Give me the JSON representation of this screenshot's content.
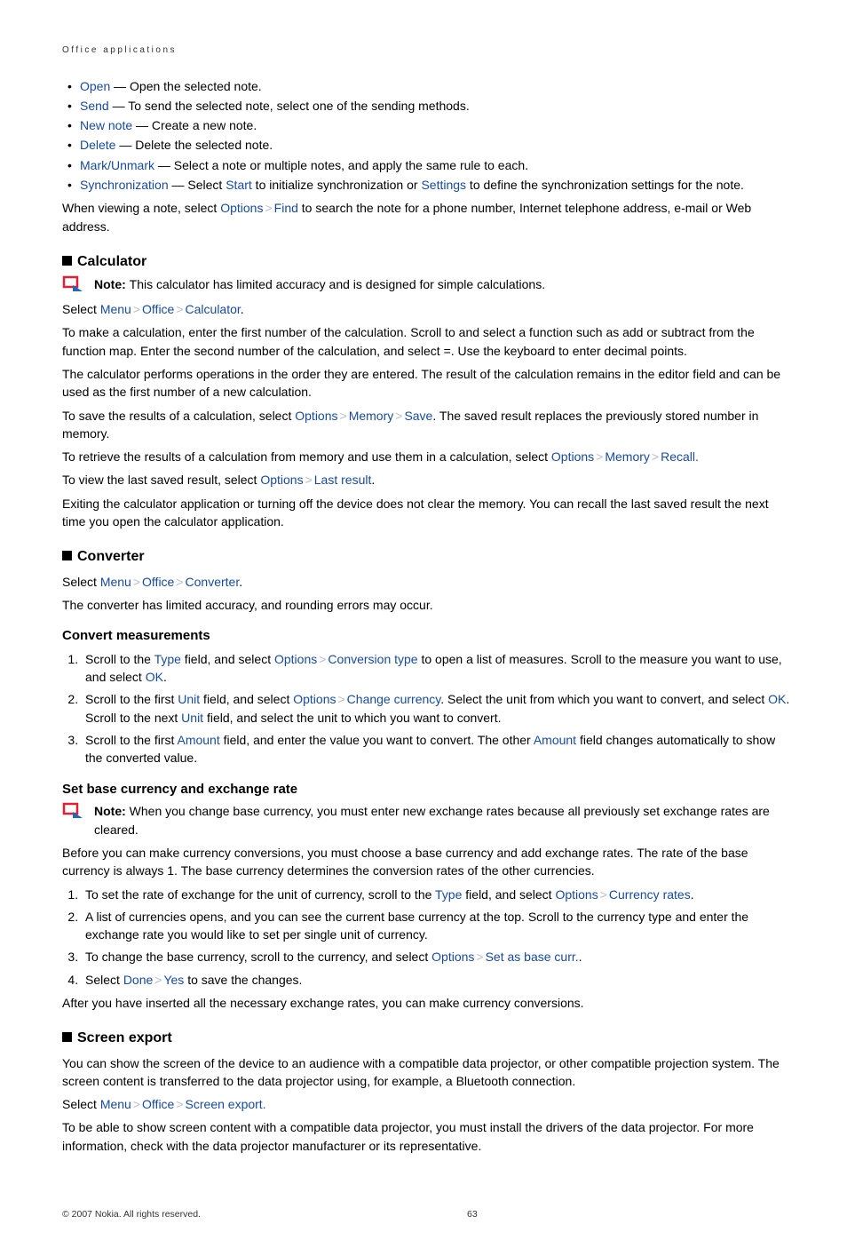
{
  "header": "Office applications",
  "bullets": {
    "items": [
      {
        "term": "Open",
        "desc": " — Open the selected note."
      },
      {
        "term": "Send",
        "desc": " — To send the selected note, select one of the sending methods."
      },
      {
        "term": "New note",
        "desc": " — Create a new note."
      },
      {
        "term": "Delete",
        "desc": " — Delete the selected note."
      },
      {
        "term": "Mark/Unmark",
        "desc": " — Select a note or multiple notes, and apply the same rule to each."
      }
    ],
    "sync": {
      "term": "Synchronization",
      "pre": " —  Select ",
      "start": "Start",
      "mid": " to initialize synchronization or ",
      "settings": "Settings",
      "post": " to define the synchronization settings for the note."
    }
  },
  "viewnote": {
    "pre": "When viewing a note, select ",
    "opt": "Options",
    "find": "Find",
    "post": " to search the note for a phone number, Internet telephone address, e-mail or Web address."
  },
  "calc": {
    "title": "Calculator",
    "note_label": "Note:  ",
    "note": "This calculator has limited accuracy and is designed for simple calculations.",
    "sel_pre": "Select ",
    "menu": "Menu",
    "office": "Office",
    "app": "Calculator",
    "period": ".",
    "p1": "To make a calculation, enter the first number of the calculation. Scroll to and select a function such as add or subtract from the function map. Enter the second number of the calculation, and select =. Use the keyboard to enter decimal points.",
    "p2": "The calculator performs operations in the order they are entered. The result of the calculation remains in the editor field and can be used as the first number of a new calculation.",
    "save": {
      "pre": "To save the results of a calculation, select ",
      "opt": "Options",
      "mem": "Memory",
      "save": "Save",
      "post": ". The saved result replaces the previously stored number in memory."
    },
    "recall": {
      "pre": "To retrieve the results of a calculation from memory and use them in a calculation, select ",
      "opt": "Options",
      "mem": "Memory",
      "rec": "Recall."
    },
    "last": {
      "pre": "To view the last saved result, select ",
      "opt": "Options",
      "lr": "Last result",
      "post": "."
    },
    "exit": "Exiting the calculator application or turning off the device does not clear the memory. You can recall the last saved result the next time you open the calculator application."
  },
  "conv": {
    "title": "Converter",
    "sel_pre": "Select ",
    "menu": "Menu",
    "office": "Office",
    "app": "Converter",
    "period": ".",
    "intro": "The converter has limited accuracy, and rounding errors may occur.",
    "meas_title": "Convert measurements",
    "m1": {
      "a": "Scroll to the ",
      "type": "Type",
      "b": " field, and select ",
      "opt": "Options",
      "ct": "Conversion type",
      "c": " to open a list of measures. Scroll to the measure you want to use, and select ",
      "ok": "OK",
      "d": "."
    },
    "m2": {
      "a": "Scroll to the first ",
      "unit": "Unit",
      "b": " field, and select ",
      "opt": "Options",
      "cc": "Change currency",
      "c": ". Select the unit from which you want to convert, and select ",
      "ok": "OK",
      "d": ". Scroll to the next ",
      "unit2": "Unit",
      "e": " field, and select the unit to which you want to convert."
    },
    "m3": {
      "a": "Scroll to the first ",
      "am": "Amount",
      "b": " field, and enter the value you want to convert. The other ",
      "am2": "Amount",
      "c": " field changes automatically to show the converted value."
    },
    "base_title": "Set base currency and exchange rate",
    "note_label": "Note:  ",
    "note": "When you change base currency, you must enter new exchange rates because all previously set exchange rates are cleared.",
    "base_p": "Before you can make currency conversions, you must choose a base currency and add exchange rates. The rate of the base currency is always 1. The base currency determines the conversion rates of the other currencies.",
    "b1": {
      "a": "To set the rate of exchange for the unit of currency, scroll to the ",
      "type": "Type",
      "b": " field, and select ",
      "opt": "Options",
      "cr": "Currency rates",
      "c": "."
    },
    "b2": "A list of currencies opens, and you can see the current base currency at the top. Scroll to the currency type and enter the exchange rate you would like to set per single unit of currency.",
    "b3": {
      "a": "To change the base currency, scroll to the currency, and select ",
      "opt": "Options",
      "sb": "Set as base curr.",
      "c": "."
    },
    "b4": {
      "a": "Select ",
      "done": "Done",
      "yes": "Yes",
      "b": " to save the changes."
    },
    "after": "After you have inserted all the necessary exchange rates, you can make currency conversions."
  },
  "scr": {
    "title": "Screen export",
    "p1": "You can show the screen of the device to an audience with a compatible data projector, or other compatible projection system. The screen content is transferred to the data projector using, for example, a Bluetooth connection.",
    "sel_pre": "Select ",
    "menu": "Menu",
    "office": "Office",
    "app": "Screen export.",
    "p2": "To be able to show screen content with a compatible data projector, you must install the drivers of the data projector. For more information, check with the data projector manufacturer or its representative."
  },
  "footer": {
    "c": "© 2007 Nokia. All rights reserved.",
    "pg": "63"
  }
}
